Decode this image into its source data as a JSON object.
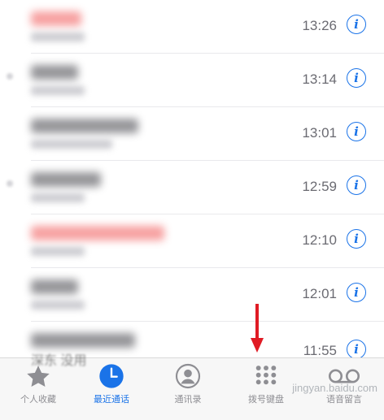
{
  "calls": [
    {
      "time": "13:26",
      "missed": true
    },
    {
      "time": "13:14",
      "missed": false
    },
    {
      "time": "13:01",
      "missed": false
    },
    {
      "time": "12:59",
      "missed": false
    },
    {
      "time": "12:10",
      "missed": true
    },
    {
      "time": "12:01",
      "missed": false
    },
    {
      "time": "11:55",
      "missed": false
    }
  ],
  "partial_text": "深东 没用",
  "info_glyph": "i",
  "tabs": [
    {
      "label": "个人收藏",
      "icon": "star-icon",
      "active": false
    },
    {
      "label": "最近通话",
      "icon": "clock-icon",
      "active": true
    },
    {
      "label": "通讯录",
      "icon": "person-circle-icon",
      "active": false
    },
    {
      "label": "拨号键盘",
      "icon": "keypad-icon",
      "active": false
    },
    {
      "label": "语音留言",
      "icon": "voicemail-icon",
      "active": false
    }
  ],
  "watermark": "jingyan.baidu.com",
  "colors": {
    "accent": "#1a73e8",
    "arrow": "#e01b24",
    "inactive": "#8e8e93"
  }
}
